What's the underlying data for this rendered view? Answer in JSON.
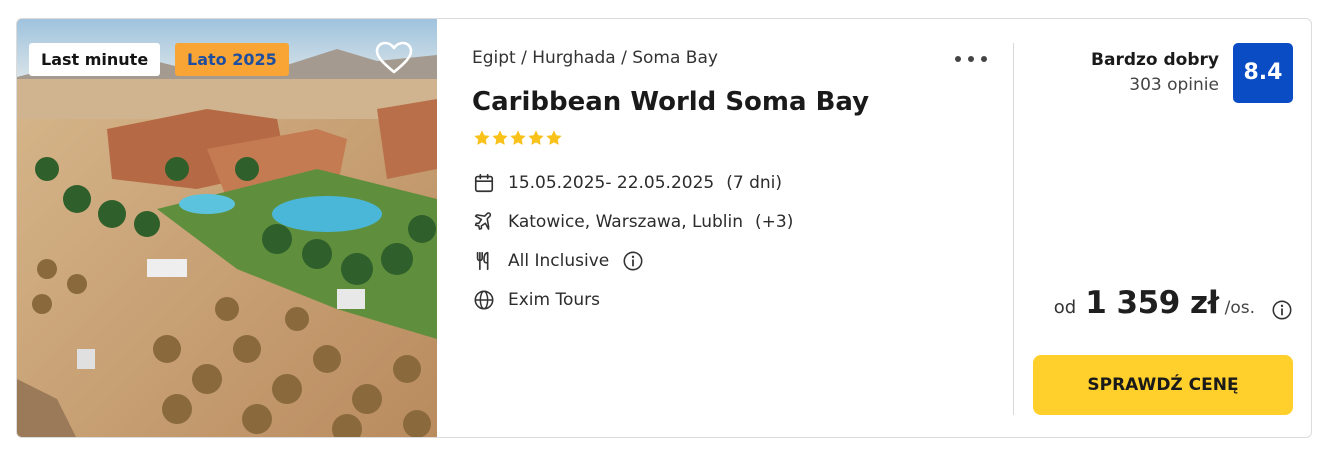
{
  "offer": {
    "badges": {
      "last_minute": "Last minute",
      "season": "Lato 2025"
    },
    "breadcrumb": "Egipt / Hurghada / Soma Bay",
    "title": "Caribbean World Soma Bay",
    "stars": 5,
    "dates": "15.05.2025- 22.05.2025",
    "duration": "(7 dni)",
    "departures": "Katowice, Warszawa, Lublin",
    "departures_extra": "(+3)",
    "board": "All Inclusive",
    "operator": "Exim Tours",
    "rating": {
      "label": "Bardzo dobry",
      "count": "303 opinie",
      "score": "8.4"
    },
    "price": {
      "prefix": "od",
      "amount": "1 359 zł",
      "unit": "/os."
    },
    "cta_label": "SPRAWDŹ CENĘ"
  },
  "colors": {
    "score_bg": "#0a4cc4",
    "cta_bg": "#ffd02b",
    "star": "#f8c21a",
    "season_badge_bg": "#f9a536",
    "season_badge_text": "#1d4ea0"
  },
  "icons": [
    "heart-icon",
    "more-icon",
    "star-icon",
    "calendar-icon",
    "plane-icon",
    "cutlery-icon",
    "info-icon",
    "globe-icon"
  ]
}
